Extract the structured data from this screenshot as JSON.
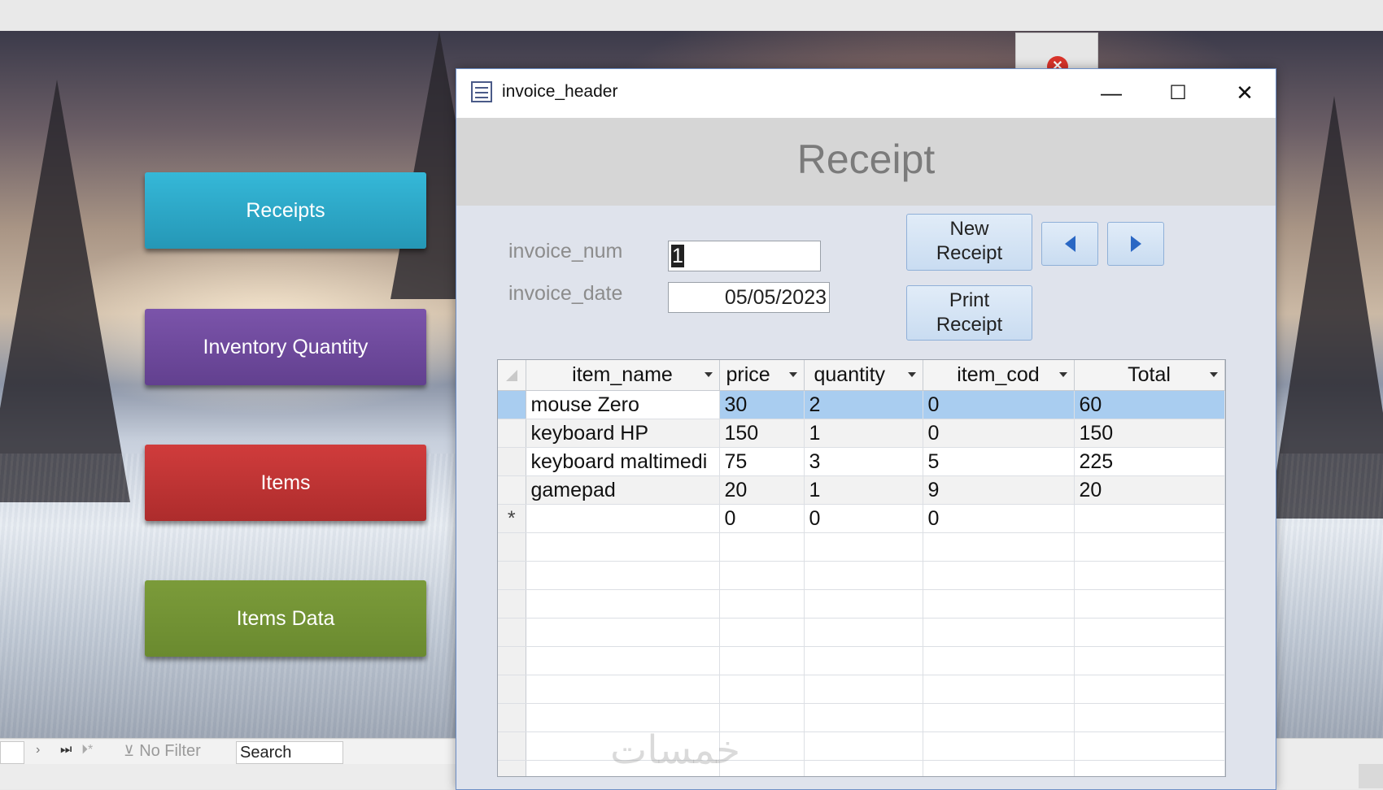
{
  "background_buttons": {
    "receipts": "Receipts",
    "inventory_quantity": "Inventory Quantity",
    "items": "Items",
    "items_data": "Items Data"
  },
  "record_nav": {
    "no_filter": "No Filter",
    "search": "Search"
  },
  "window": {
    "title": "invoice_header",
    "minimize_glyph": "—",
    "maximize_glyph": "☐",
    "close_glyph": "✕"
  },
  "form": {
    "title": "Receipt",
    "invoice_num_label": "invoice_num",
    "invoice_num_value": "1",
    "invoice_date_label": "invoice_date",
    "invoice_date_value": "05/05/2023",
    "new_receipt_line1": "New",
    "new_receipt_line2": "Receipt",
    "print_receipt_line1": "Print",
    "print_receipt_line2": "Receipt"
  },
  "subform": {
    "columns": [
      "item_name",
      "price",
      "quantity",
      "item_cod",
      "Total"
    ],
    "rows": [
      {
        "item_name": "mouse Zero",
        "price": "30",
        "quantity": "2",
        "item_cod": "0",
        "total": "60"
      },
      {
        "item_name": "keyboard HP",
        "price": "150",
        "quantity": "1",
        "item_cod": "0",
        "total": "150"
      },
      {
        "item_name": "keyboard maltimedi",
        "price": "75",
        "quantity": "3",
        "item_cod": "5",
        "total": "225"
      },
      {
        "item_name": "gamepad",
        "price": "20",
        "quantity": "1",
        "item_cod": "9",
        "total": "20"
      }
    ],
    "new_row": {
      "marker": "*",
      "item_name": "",
      "price": "0",
      "quantity": "0",
      "item_cod": "0",
      "total": ""
    }
  },
  "watermark": "خمسات",
  "colors": {
    "receipts_button": "#2fa9c9",
    "inventory_button": "#6f4b9e",
    "items_button": "#c23434",
    "items_data_button": "#739336",
    "selected_row": "#a9cdf0"
  }
}
